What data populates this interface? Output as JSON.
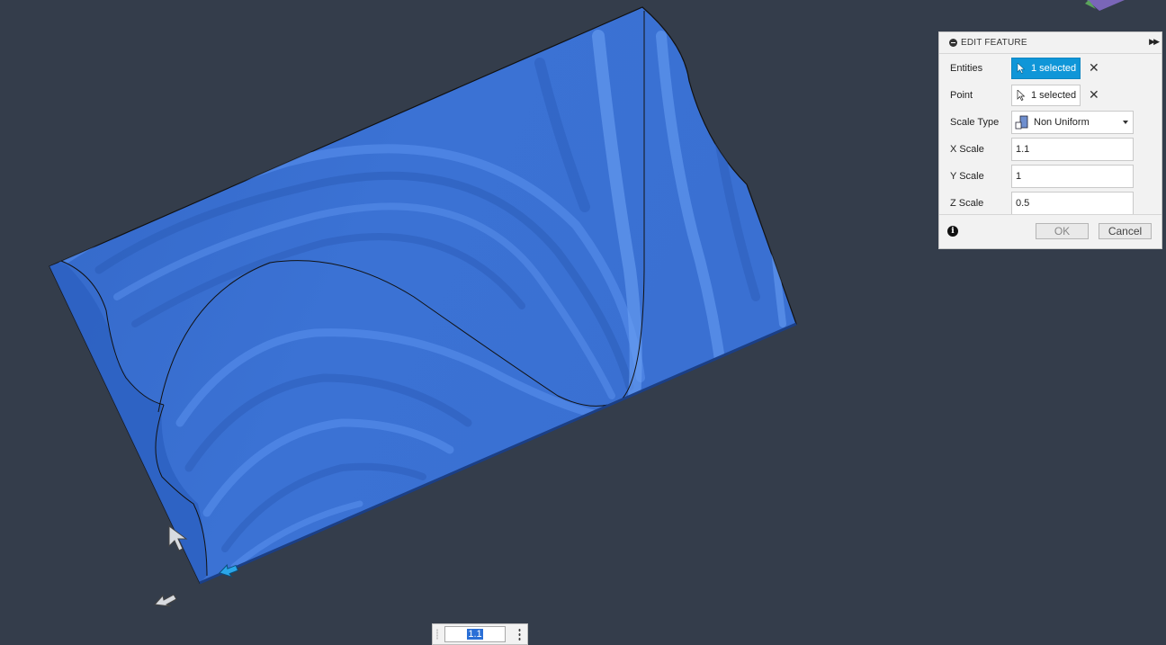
{
  "panel": {
    "title": "EDIT FEATURE",
    "rows": {
      "entities": {
        "label": "Entities",
        "value": "1 selected"
      },
      "point": {
        "label": "Point",
        "value": "1 selected"
      },
      "scale_type": {
        "label": "Scale Type",
        "value": "Non Uniform"
      },
      "x_scale": {
        "label": "X Scale",
        "value": "1.1"
      },
      "y_scale": {
        "label": "Y Scale",
        "value": "1"
      },
      "z_scale": {
        "label": "Z Scale",
        "value": "0.5"
      }
    },
    "buttons": {
      "ok": "OK",
      "cancel": "Cancel"
    }
  },
  "value_input": {
    "value": "1.1"
  },
  "colors": {
    "background": "#343d4b",
    "surface": "#3a6fd0",
    "selection_accent": "#0f96d8"
  },
  "icons": [
    "cursor-icon",
    "clear-icon",
    "scale-type-icon",
    "info-icon",
    "collapse-icon",
    "expand-icon",
    "kebab-icon",
    "grip-icon",
    "move-arrow-icon"
  ]
}
